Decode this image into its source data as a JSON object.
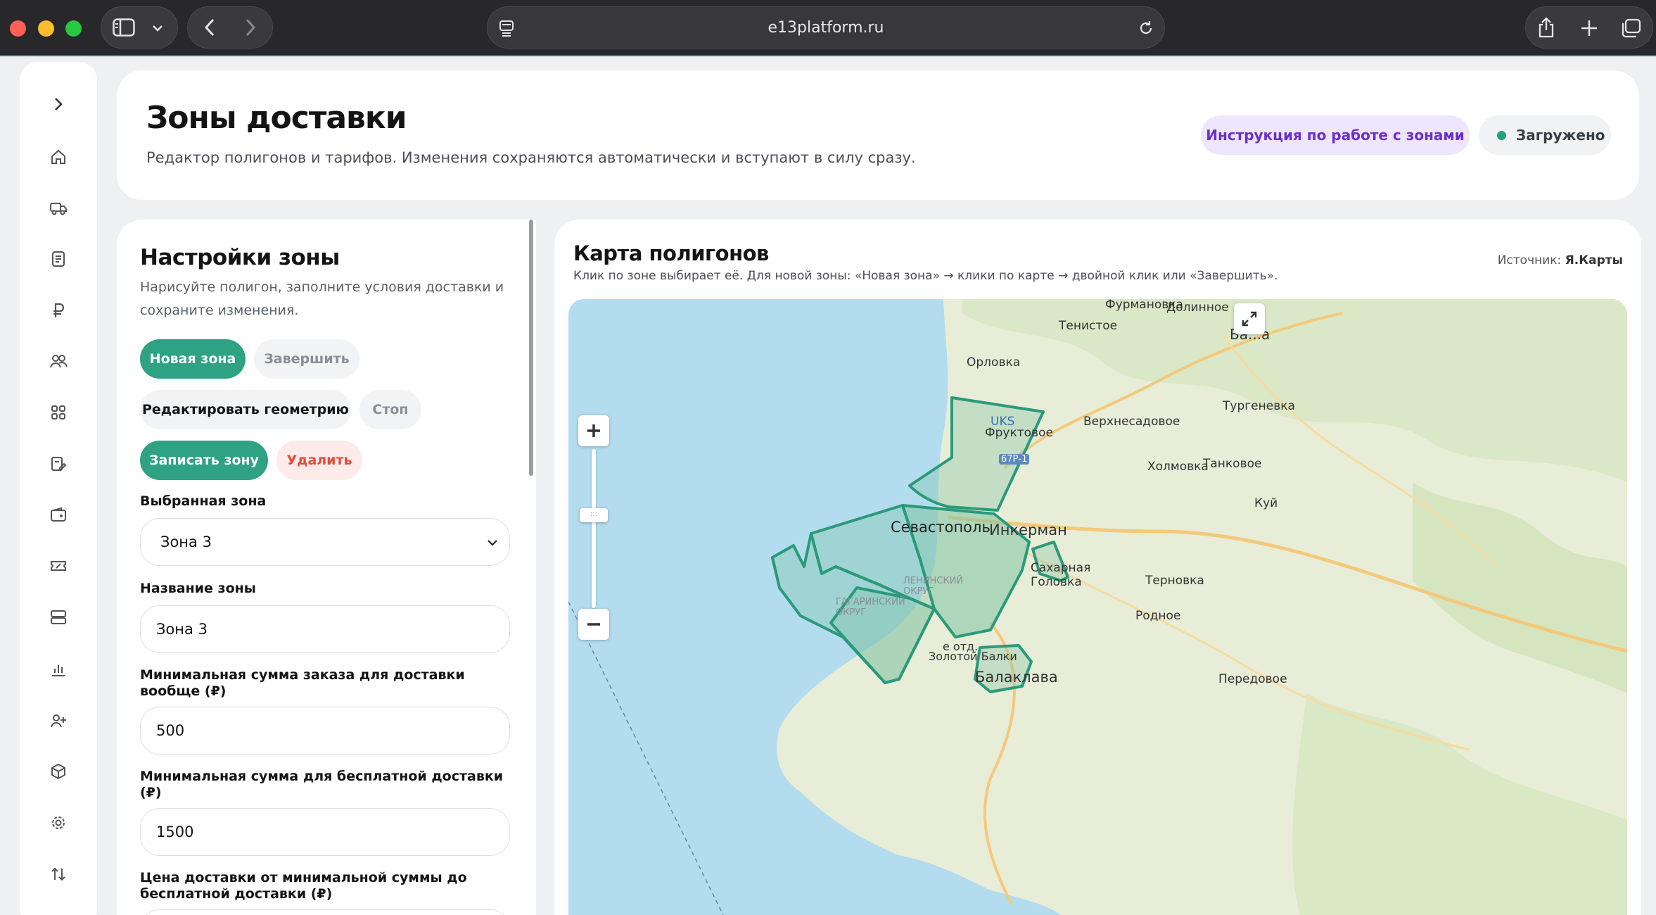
{
  "browser": {
    "url": "e13platform.ru"
  },
  "header": {
    "title": "Зоны доставки",
    "subtitle": "Редактор полигонов и тарифов. Изменения сохраняются автоматически и вступают в силу сразу.",
    "instructions_label": "Инструкция по работе с зонами",
    "status_label": "Загружено",
    "status_color": "#22a37a"
  },
  "settings": {
    "title": "Настройки зоны",
    "description": "Нарисуйте полигон, заполните условия доставки и сохраните изменения.",
    "buttons": {
      "new_zone": "Новая зона",
      "finish": "Завершить",
      "edit_geometry": "Редактировать геометрию",
      "stop": "Стоп",
      "save_zone": "Записать зону",
      "delete": "Удалить"
    },
    "selected_zone_label": "Выбранная зона",
    "selected_zone_value": "Зона 3",
    "zone_name_label": "Название зоны",
    "zone_name_value": "Зона 3",
    "min_order_label": "Минимальная сумма заказа для доставки вообще (₽)",
    "min_order_value": "500",
    "free_delivery_label": "Минимальная сумма для бесплатной доставки (₽)",
    "free_delivery_value": "1500",
    "delivery_price_label": "Цена доставки от минимальной суммы до бесплатной доставки (₽)"
  },
  "map": {
    "title": "Карта полигонов",
    "hint": "Клик по зоне выбирает её. Для новой зоны: «Новая зона» → клики по карте → двойной клик или «Завершить».",
    "source_label": "Источник:",
    "source_value": "Я.Карты",
    "places": {
      "furmanovka": "Фурмановка",
      "dolinnoe": "Долинное",
      "tenistoe": "Тенистое",
      "orlovka": "Орловка",
      "turgenevka": "Тургеневка",
      "uks": "UKS",
      "fruktovoe": "Фруктовое",
      "verkhnesadovoe": "Верхнесадовое",
      "road_67r1": "67Р-1",
      "kholmovka": "Холмовка",
      "tankovoe": "Танковое",
      "sevastopol": "Севастополь",
      "inkerman": "Инкерман",
      "leninsky": "ЛЕНИНСКИЙ ОКРУГ",
      "gagarinsky": "ГАГАРИНСКИЙ ОКРУГ",
      "sakharnaya": "Сахарная Головка",
      "ternovka": "Терновка",
      "rodnoe": "Родное",
      "zolotaya": "Золотой Балки",
      "otd": "е отд.",
      "balaklava": "Балаклава",
      "peredovoe": "Передовое",
      "kuy": "Куй",
      "bakh": "Ба...а"
    },
    "colors": {
      "water": "#b3dcee",
      "land": "#e9eedb",
      "zone_stroke": "#2a9a7a",
      "zone_fill": "#7ec3a2"
    }
  }
}
